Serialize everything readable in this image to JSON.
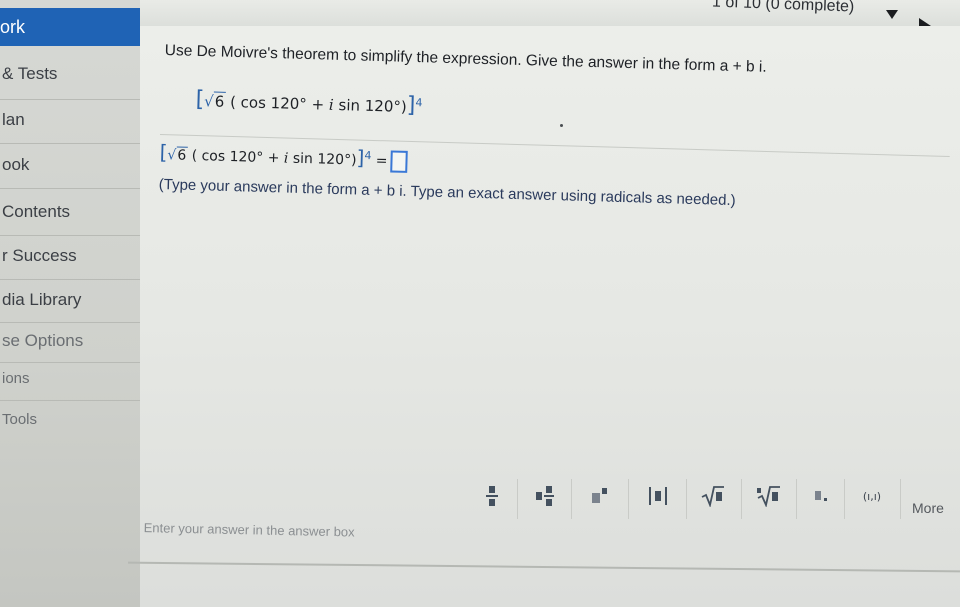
{
  "sidebar": {
    "active": "ork",
    "items": [
      "& Tests",
      "lan",
      "ook",
      "Contents",
      "r Success",
      "dia Library",
      "se Options",
      "ions",
      "Tools"
    ]
  },
  "pager": {
    "text": "1 of 10 (0 complete)"
  },
  "question": {
    "instruction": "Use De Moivre's theorem to simplify the expression. Give the answer in the form a + b i.",
    "expr_radicand": "6",
    "expr_cos": "( cos 120°",
    "expr_plus": "+",
    "expr_i": "i",
    "expr_sin": "sin 120°)",
    "expr_exp": "4",
    "equals": "=",
    "hint": "(Type your answer in the form a + b i. Type an exact answer using radicals as needed.)"
  },
  "toolbar": {
    "icons": [
      "fraction-icon",
      "mixed-number-icon",
      "exponent-icon",
      "absolute-value-icon",
      "square-root-icon",
      "nth-root-icon",
      "decimal-icon",
      "ordered-pair-icon"
    ],
    "ordered_pair_label": "(ı,ı)",
    "more_label": "More"
  },
  "answer": {
    "placeholder": "Enter your answer in the answer box"
  },
  "colors": {
    "accent": "#1f63b5",
    "math_blue": "#2d63a8",
    "answer_box": "#3a78d6"
  }
}
